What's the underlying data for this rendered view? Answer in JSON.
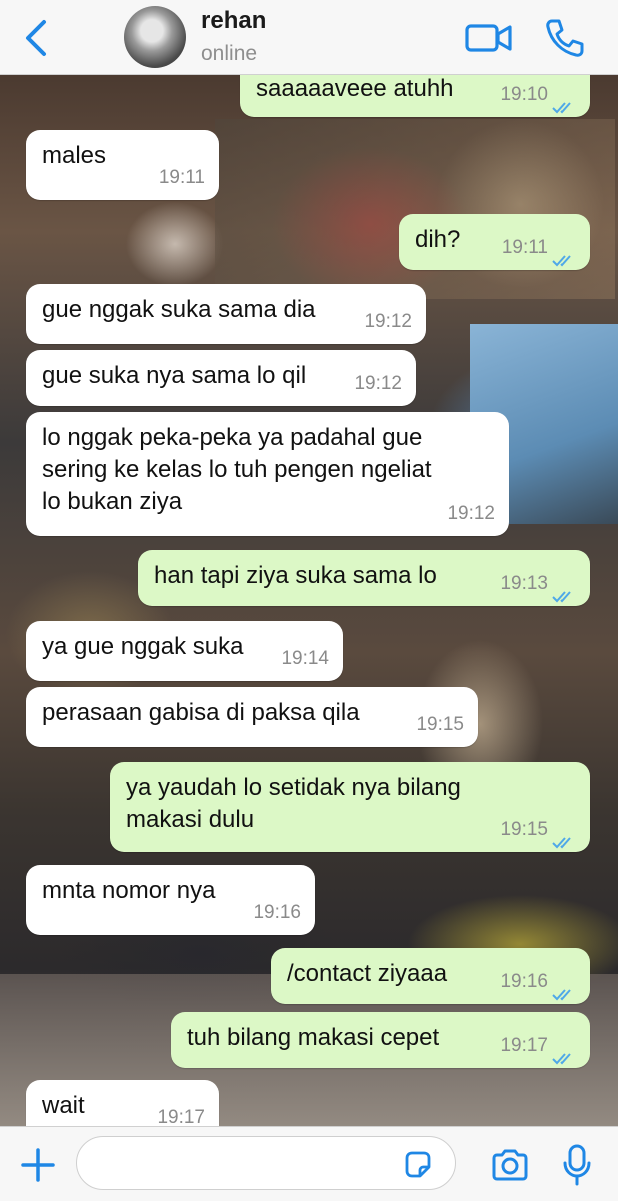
{
  "header": {
    "contact_name": "rehan",
    "status": "online"
  },
  "icons": {
    "back": "chevron-left-icon",
    "video": "video-camera-icon",
    "call": "phone-icon",
    "add": "plus-icon",
    "sticker": "sticker-icon",
    "camera": "camera-icon",
    "mic": "microphone-icon",
    "read_receipt": "double-check-icon"
  },
  "colors": {
    "accent": "#1f87e5",
    "incoming_bubble": "#ffffff",
    "outgoing_bubble": "#dcf8c6",
    "read_ticks": "#4fa8e8"
  },
  "messages": [
    {
      "dir": "out",
      "text": "saaaaaveee atuhh",
      "time": "19:10",
      "read": true
    },
    {
      "dir": "in",
      "text": "males",
      "time": "19:11"
    },
    {
      "dir": "out",
      "text": "dih?",
      "time": "19:11",
      "read": true
    },
    {
      "dir": "in",
      "text": "gue nggak suka sama dia",
      "time": "19:12"
    },
    {
      "dir": "in",
      "text": "gue suka nya sama lo qil",
      "time": "19:12"
    },
    {
      "dir": "in",
      "text": "lo nggak peka-peka ya padahal gue\nsering ke kelas lo tuh pengen ngeliat\nlo bukan ziya",
      "time": "19:12"
    },
    {
      "dir": "out",
      "text": "han tapi ziya suka sama lo",
      "time": "19:13",
      "read": true
    },
    {
      "dir": "in",
      "text": "ya gue nggak suka",
      "time": "19:14"
    },
    {
      "dir": "in",
      "text": "perasaan gabisa di paksa qila",
      "time": "19:15"
    },
    {
      "dir": "out",
      "text": "ya yaudah lo setidak nya bilang\nmakasi dulu",
      "time": "19:15",
      "read": true
    },
    {
      "dir": "in",
      "text": "mnta nomor nya",
      "time": "19:16"
    },
    {
      "dir": "out",
      "text": "/contact ziyaaa",
      "time": "19:16",
      "read": true
    },
    {
      "dir": "out",
      "text": "tuh bilang makasi cepet",
      "time": "19:17",
      "read": true
    },
    {
      "dir": "in",
      "text": "wait",
      "time": "19:17"
    }
  ],
  "composer": {
    "value": "",
    "placeholder": ""
  }
}
